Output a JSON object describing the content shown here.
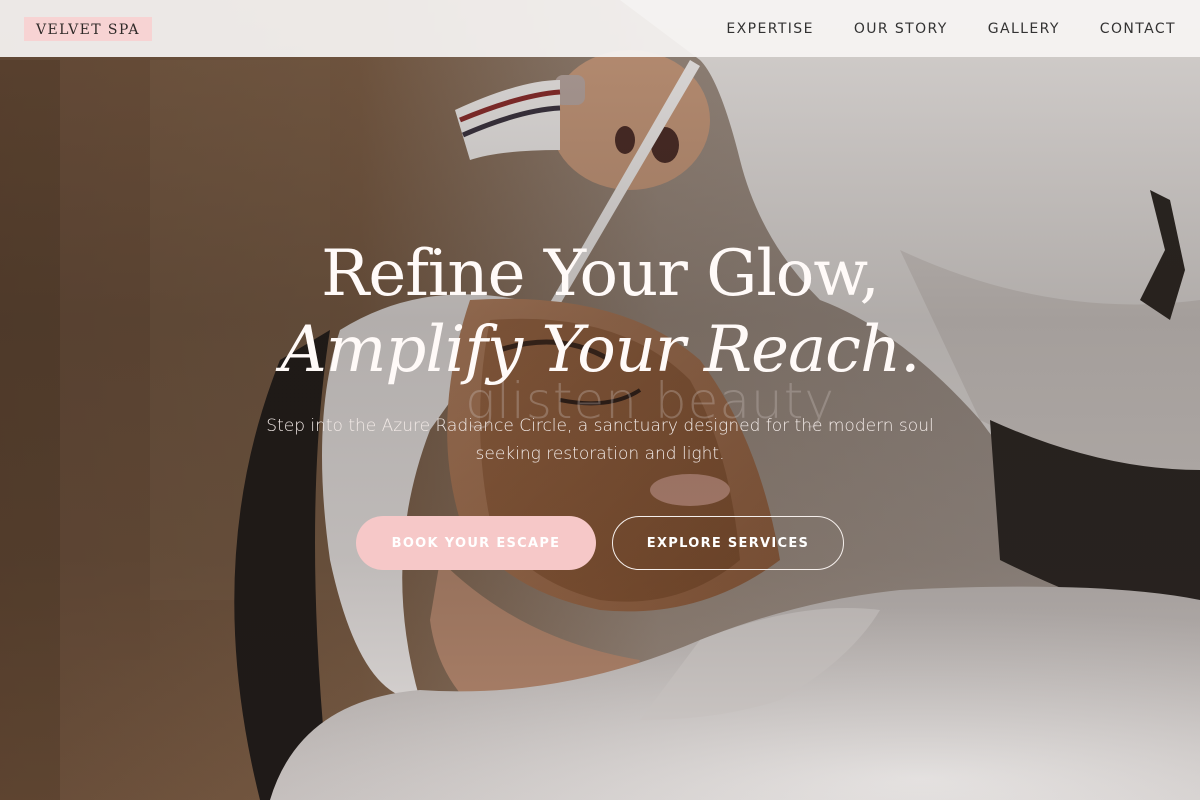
{
  "brand": {
    "name": "VELVET SPA"
  },
  "nav": {
    "items": [
      {
        "label": "EXPERTISE"
      },
      {
        "label": "OUR STORY"
      },
      {
        "label": "GALLERY"
      },
      {
        "label": "CONTACT"
      }
    ]
  },
  "hero": {
    "headline_line1": "Refine Your Glow,",
    "headline_line2": "Amplify Your Reach.",
    "subtext": "Step into the Azure Radiance Circle, a sanctuary designed for the modern soul seeking restoration and light.",
    "photo_watermark": "glisten beauty",
    "primary_cta": "BOOK YOUR ESCAPE",
    "secondary_cta": "EXPLORE SERVICES"
  },
  "colors": {
    "brand_pink": "#f7d3d3",
    "button_pink": "#f6c8c8",
    "header_bg": "#f6f4f3",
    "nav_text": "#333333",
    "hero_text": "#fffaf8"
  }
}
